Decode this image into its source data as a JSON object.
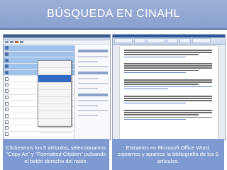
{
  "slide": {
    "title": "BÚSQUEDA EN CINAHL",
    "caption_left": "Clickeamos los 5 artículos, seleccionamos \"Copy As\" y \"Formatted Citation\" pulsando el botón derecho del ratón.",
    "caption_right": "Entramos en Microsoft Office Word, copiamos y aparece la bibliografía de los 5 artículos."
  },
  "colors": {
    "title_bar": "#8aa1cf",
    "caption_bg": "#7f9ad0",
    "selection": "#9fc2ea",
    "menu_highlight": "#316ac5"
  }
}
